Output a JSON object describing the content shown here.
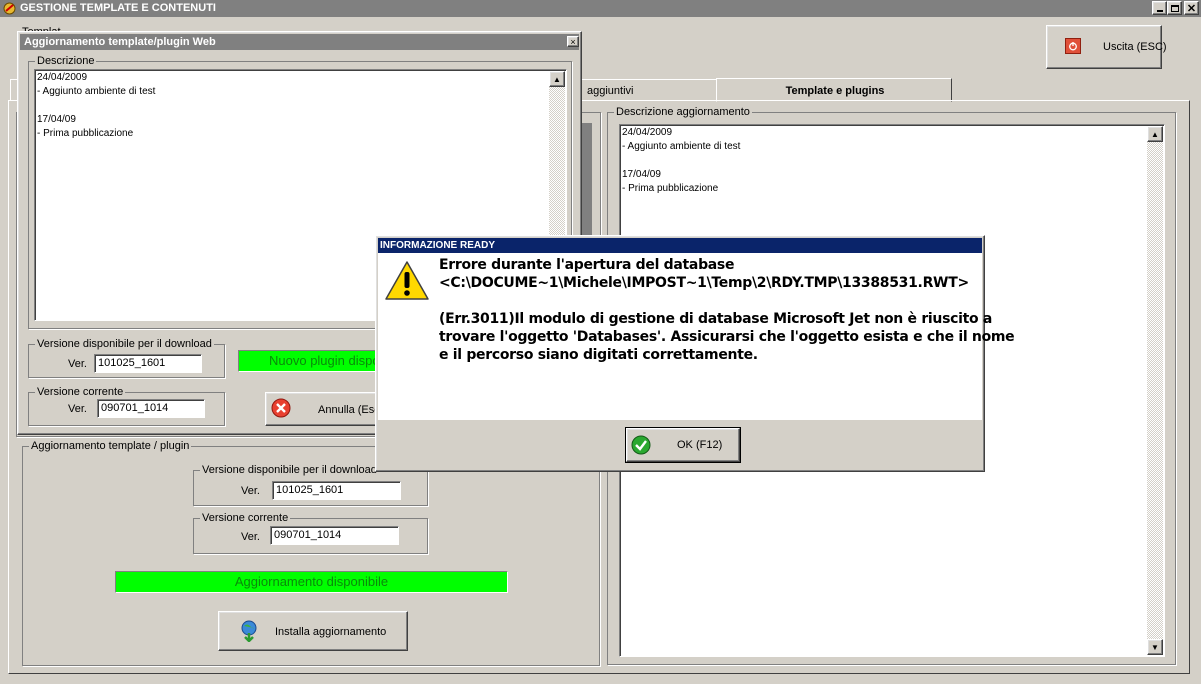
{
  "app": {
    "title": "GESTIONE TEMPLATE E CONTENUTI",
    "partial_label": "Templat"
  },
  "exit_button": {
    "label": "Uscita (ESC)"
  },
  "tabs": [
    {
      "label": "aggiuntivi"
    },
    {
      "label": "Template e plugins"
    }
  ],
  "right_panel": {
    "legend": "Descrizione aggiornamento",
    "description": "24/04/2009\n- Aggiunto ambiente di test\n\n17/04/09\n- Prima pubblicazione"
  },
  "update_panel": {
    "legend": "Aggiornamento template / plugin",
    "download_group": {
      "legend": "Versione disponibile per il download",
      "ver_label": "Ver.",
      "value": "101025_1601"
    },
    "current_group": {
      "legend": "Versione corrente",
      "ver_label": "Ver.",
      "value": "090701_1014"
    },
    "status": "Aggiornamento disponibile",
    "install_button": "Installa aggiornamento"
  },
  "web_dialog": {
    "title": "Aggiornamento template/plugin Web",
    "close": "×",
    "desc_legend": "Descrizione",
    "description": "24/04/2009\n- Aggiunto ambiente di test\n\n17/04/09\n- Prima pubblicazione",
    "download_group": {
      "legend": "Versione disponibile per il download",
      "ver_label": "Ver.",
      "value": "101025_1601"
    },
    "current_group": {
      "legend": "Versione corrente",
      "ver_label": "Ver.",
      "value": "090701_1014"
    },
    "status": "Nuovo plugin disponibile",
    "cancel_button": "Annulla (Esc)"
  },
  "error_dialog": {
    "title": "INFORMAZIONE READY",
    "line1": "Errore durante l'apertura del database",
    "line2": "<C:\\DOCUME~1\\Michele\\IMPOST~1\\Temp\\2\\RDY.TMP\\13388531.RWT>",
    "line3": "(Err.3011)Il modulo di gestione di database Microsoft Jet non è riuscito a",
    "line4": "trovare l'oggetto 'Databases'. Assicurarsi che l'oggetto esista e che il nome",
    "line5": "e il percorso siano digitati correttamente.",
    "ok_button": "OK (F12)"
  },
  "colors": {
    "green_status": "#00ff00",
    "title_active": "#0a246a",
    "title_inactive": "#808080"
  }
}
